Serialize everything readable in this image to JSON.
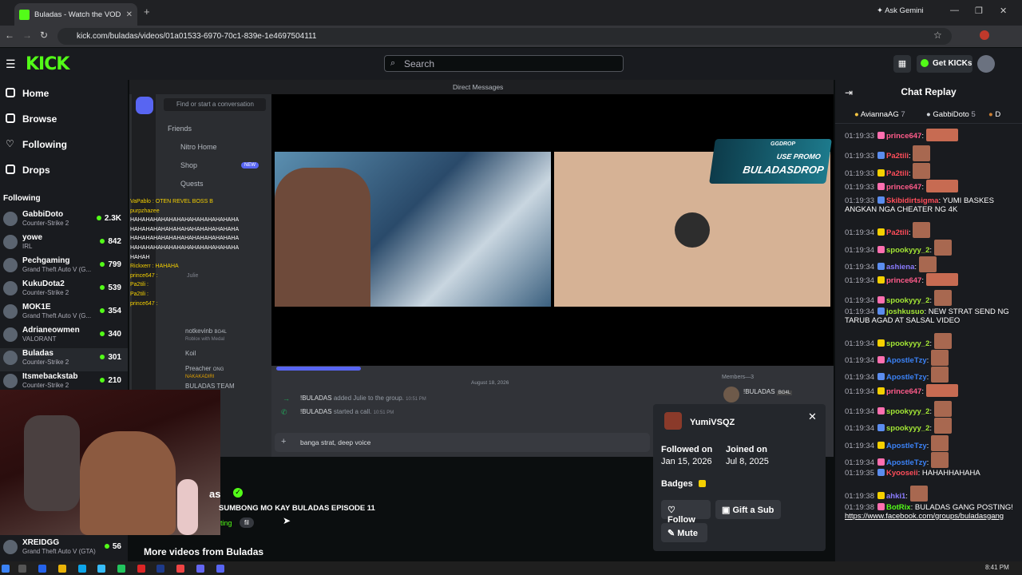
{
  "browser": {
    "tab_title": "Buladas - Watch the VOD o",
    "url": "kick.com/buladas/videos/01a01533-6970-70c1-839e-1e4697504111",
    "ask_gemini": "Ask Gemini"
  },
  "header": {
    "logo": "KICK",
    "search_placeholder": "Search",
    "get_kicks": "Get KICKs"
  },
  "nav": {
    "home": "Home",
    "browse": "Browse",
    "following": "Following",
    "drops": "Drops",
    "following_section": "Following"
  },
  "following": [
    {
      "name": "GabbiDoto",
      "game": "Counter-Strike 2",
      "viewers": "2.3K"
    },
    {
      "name": "yowe",
      "game": "IRL",
      "viewers": "842"
    },
    {
      "name": "Pechgaming",
      "game": "Grand Theft Auto V (G...",
      "viewers": "799"
    },
    {
      "name": "KukuDota2",
      "game": "Counter-Strike 2",
      "viewers": "539"
    },
    {
      "name": "MOK1E",
      "game": "Grand Theft Auto V (G...",
      "viewers": "354"
    },
    {
      "name": "Adrianeowmen",
      "game": "VALORANT",
      "viewers": "340"
    },
    {
      "name": "Buladas",
      "game": "Counter-Strike 2",
      "viewers": "301"
    },
    {
      "name": "Itsmebackstab",
      "game": "Counter-Strike 2",
      "viewers": "210"
    }
  ],
  "following_bottom": {
    "name": "XREIDGG",
    "game": "Grand Theft Auto V (GTA)",
    "viewers": "56"
  },
  "discord": {
    "title": "Direct Messages",
    "find": "Find or start a conversation",
    "friends": "Friends",
    "nitro": "Nitro Home",
    "shop": "Shop",
    "new": "NEW",
    "quests": "Quests",
    "date": "August 18, 2026",
    "msg1_user": "!BULADAS",
    "msg1_text": "added Julie to the group.",
    "msg1_time": "10:51 PM",
    "msg2_user": "!BULADAS",
    "msg2_text": "started a call.",
    "msg2_time": "10:51 PM",
    "input": "banga strat, deep voice",
    "members": "Members—3",
    "member1": "!BULADAS",
    "member1_tag": "BG4L",
    "promo1": "GGDROP",
    "promo2": "USE PROMO",
    "promo3": "BULADASDROP",
    "dm1": "notkevinb",
    "dm1_tag": "BG4L",
    "dm1_sub": "Roblox with Medal",
    "dm2": "Koil",
    "dm3": "Preacher",
    "dm3_tag": "ONG",
    "dm3_sub": "NAKAKADIRI",
    "dm4": "BULADAS TEAM",
    "dm5": "Julie"
  },
  "overlay_chat": [
    "VaPablo : OTEN REVEL BOSS B",
    "purpzhazee",
    "HAHAHAHAHAHAHAHAHAHAHAHAHAHA",
    "HAHAHAHAHAHAHAHAHAHAHAHAHAHA",
    "HAHAHAHAHAHAHAHAHAHAHAHAHAHA",
    "HAHAHAHAHAHAHAHAHAHAHAHAHAHA",
    "HAHAH",
    "Rickxerr : HAHAHA",
    "prince647 :",
    "Pa2tili :",
    "Pa2tili :",
    "prince647 :"
  ],
  "video_info": {
    "name_frag": "as",
    "title": "SUMBONG MO KAY BULADAS EPISODE 11",
    "tag_frag": "ting",
    "lang": "fil",
    "more": "More videos from Buladas"
  },
  "chat": {
    "title": "Chat Replay",
    "top_gifters": [
      {
        "name": "AviannaAG",
        "count": "7"
      },
      {
        "name": "GabbiDoto",
        "count": "5"
      },
      {
        "name": "D",
        "count": ""
      }
    ],
    "messages": [
      {
        "t": "01:19:33",
        "user": "prince647",
        "color": "#ff5b8a",
        "text": "",
        "emote": "wide"
      },
      {
        "t": "01:19:33",
        "user": "Pa2tili",
        "color": "#ff4d5a",
        "text": "",
        "emote": "sm"
      },
      {
        "t": "01:19:33",
        "user": "Pa2tili",
        "color": "#ff4d5a",
        "text": "",
        "emote": "sm"
      },
      {
        "t": "01:19:33",
        "user": "prince647",
        "color": "#ff5b8a",
        "text": "",
        "emote": "wide"
      },
      {
        "t": "01:19:33",
        "user": "Skibidirtsigma",
        "color": "#ff4d5a",
        "text": "YUMI BASKES ANGKAN NGA CHEATER NG 4K",
        "emote": ""
      },
      {
        "t": "01:19:34",
        "user": "Pa2tili",
        "color": "#ff4d5a",
        "text": "",
        "emote": "sm"
      },
      {
        "t": "01:19:34",
        "user": "spookyyy_2",
        "color": "#a3e635",
        "text": "",
        "emote": "sm"
      },
      {
        "t": "01:19:34",
        "user": "ashiena",
        "color": "#8b7cff",
        "text": "",
        "emote": "sm"
      },
      {
        "t": "01:19:34",
        "user": "prince647",
        "color": "#ff5b8a",
        "text": "",
        "emote": "wide"
      },
      {
        "t": "01:19:34",
        "user": "spookyyy_2",
        "color": "#a3e635",
        "text": "",
        "emote": "sm"
      },
      {
        "t": "01:19:34",
        "user": "joshkusuo",
        "color": "#a3e635",
        "text": "NEW STRAT SEND NG TARUB AGAD AT SALSAL VIDEO",
        "emote": ""
      },
      {
        "t": "01:19:34",
        "user": "spookyyy_2",
        "color": "#a3e635",
        "text": "",
        "emote": "sm"
      },
      {
        "t": "01:19:34",
        "user": "ApostleTzy",
        "color": "#3b82f6",
        "text": "",
        "emote": "sm"
      },
      {
        "t": "01:19:34",
        "user": "ApostleTzy",
        "color": "#3b82f6",
        "text": "",
        "emote": "sm"
      },
      {
        "t": "01:19:34",
        "user": "prince647",
        "color": "#ff5b8a",
        "text": "",
        "emote": "wide"
      },
      {
        "t": "01:19:34",
        "user": "spookyyy_2",
        "color": "#a3e635",
        "text": "",
        "emote": "sm"
      },
      {
        "t": "01:19:34",
        "user": "spookyyy_2",
        "color": "#a3e635",
        "text": "",
        "emote": "sm"
      },
      {
        "t": "01:19:34",
        "user": "ApostleTzy",
        "color": "#3b82f6",
        "text": "",
        "emote": "sm"
      },
      {
        "t": "01:19:34",
        "user": "ApostleTzy",
        "color": "#3b82f6",
        "text": "",
        "emote": "sm"
      },
      {
        "t": "01:19:35",
        "user": "Kyooseii",
        "color": "#ff4d5a",
        "text": "HAHAHHAHAHA",
        "emote": ""
      },
      {
        "t": "01:19:38",
        "user": "ahki1",
        "color": "#8b7cff",
        "text": "",
        "emote": "sm"
      },
      {
        "t": "01:19:38",
        "user": "BotRix",
        "color": "#53fc18",
        "text": "BULADAS GANG POSTING!",
        "link": "https://www.facebook.com/groups/buladasgang",
        "emote": ""
      }
    ]
  },
  "popup": {
    "user": "YumiVSQZ",
    "followed_label": "Followed on",
    "followed_value": "Jan 15, 2026",
    "joined_label": "Joined on",
    "joined_value": "Jul 8, 2025",
    "badges": "Badges",
    "follow": "Follow",
    "gift": "Gift a Sub",
    "mute": "Mute"
  },
  "taskbar": {
    "time": "8:41 PM"
  },
  "colors": {
    "kick_green": "#53fc18",
    "bg": "#0b0e0f",
    "panel": "#191b1f"
  }
}
